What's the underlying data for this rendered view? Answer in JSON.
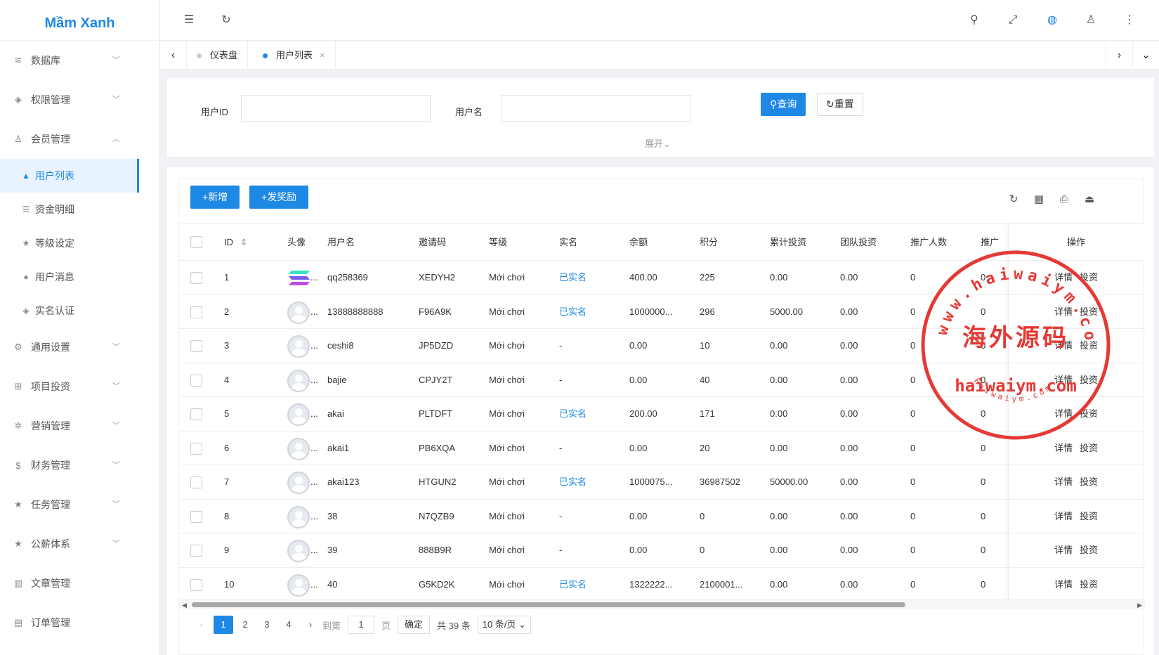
{
  "app": {
    "logo": "Mầm Xanh"
  },
  "sidebar": {
    "items": [
      {
        "label": "数据库",
        "icon": "stack-icon",
        "glyph": "≋",
        "chevron": "﹀"
      },
      {
        "label": "权限管理",
        "icon": "shield-icon",
        "glyph": "◈",
        "chevron": "﹀"
      },
      {
        "label": "会员管理",
        "icon": "user-icon",
        "glyph": "♙",
        "chevron": "︿"
      }
    ],
    "sub_items": [
      {
        "label": "用户列表",
        "icon": "user-fill-icon",
        "glyph": "▲"
      },
      {
        "label": "资金明细",
        "icon": "list-icon",
        "glyph": "☰"
      },
      {
        "label": "等级设定",
        "icon": "star-icon",
        "glyph": "★"
      },
      {
        "label": "用户消息",
        "icon": "message-icon",
        "glyph": "●"
      },
      {
        "label": "实名认证",
        "icon": "verify-icon",
        "glyph": "◈"
      }
    ],
    "items_after": [
      {
        "label": "通用设置",
        "icon": "gear-icon",
        "glyph": "⚙",
        "chevron": "﹀"
      },
      {
        "label": "项目投资",
        "icon": "grid-icon",
        "glyph": "⊞",
        "chevron": "﹀"
      },
      {
        "label": "营销管理",
        "icon": "marketing-icon",
        "glyph": "✲",
        "chevron": "﹀"
      },
      {
        "label": "财务管理",
        "icon": "dollar-icon",
        "glyph": "$",
        "chevron": "﹀"
      },
      {
        "label": "任务管理",
        "icon": "star-icon",
        "glyph": "★",
        "chevron": "﹀"
      },
      {
        "label": "公薪体系",
        "icon": "star-icon",
        "glyph": "★",
        "chevron": "﹀"
      },
      {
        "label": "文章管理",
        "icon": "book-icon",
        "glyph": "▥",
        "chevron": ""
      },
      {
        "label": "订单管理",
        "icon": "clipboard-icon",
        "glyph": "▤",
        "chevron": ""
      }
    ]
  },
  "topbar": {
    "icons": [
      {
        "name": "menu-fold-icon",
        "glyph": "☰"
      },
      {
        "name": "refresh-icon",
        "glyph": "↻"
      },
      {
        "name": "search-icon",
        "glyph": "⚲"
      },
      {
        "name": "fullscreen-icon",
        "glyph": "⤢"
      },
      {
        "name": "globe-icon",
        "glyph": "◍"
      },
      {
        "name": "user-icon",
        "glyph": "♙"
      },
      {
        "name": "more-vertical-icon",
        "glyph": "⋮"
      }
    ]
  },
  "tabs": {
    "prev_glyph": "‹",
    "next_glyph": "›",
    "dropdown_glyph": "⌄",
    "close_glyph": "×",
    "items": [
      {
        "label": "仪表盘"
      },
      {
        "label": "用户列表"
      }
    ]
  },
  "search": {
    "user_id_label": "用户ID",
    "username_label": "用户名",
    "user_id_value": "",
    "username_value": "",
    "query_label": "查询",
    "query_glyph": "⚲",
    "reset_label": "重置",
    "reset_glyph": "↻",
    "expand_label": "展开",
    "expand_glyph": "⌄"
  },
  "toolbar": {
    "add_label": "新增",
    "reward_label": "发奖励",
    "plus_glyph": "+",
    "icons": [
      {
        "name": "refresh-icon",
        "glyph": "↻"
      },
      {
        "name": "columns-icon",
        "glyph": "▦"
      },
      {
        "name": "print-icon",
        "glyph": "⎙"
      },
      {
        "name": "export-icon",
        "glyph": "⏏"
      }
    ]
  },
  "table": {
    "columns": [
      "ID",
      "头像",
      "用户名",
      "邀请码",
      "等级",
      "实名",
      "余额",
      "积分",
      "累计投资",
      "团队投资",
      "推广人数",
      "推广",
      "操作"
    ],
    "sort_glyph": "⇕",
    "detail_label": "详情",
    "invest_label": "投资",
    "rows": [
      {
        "id": "1",
        "avatar": "logo",
        "avatar_ellipsis": "...",
        "username": "qq258369",
        "invite": "XEDYH2",
        "level": "Mới chơi",
        "realname": "已实名",
        "balance": "400.00",
        "points": "225",
        "total_invest": "0.00",
        "team_invest": "0.00",
        "promoted": "0",
        "promo2": "0"
      },
      {
        "id": "2",
        "avatar": "default",
        "avatar_ellipsis": "...",
        "username": "13888888888",
        "invite": "F96A9K",
        "level": "Mới chơi",
        "realname": "已实名",
        "balance": "1000000...",
        "points": "296",
        "total_invest": "5000.00",
        "team_invest": "0.00",
        "promoted": "0",
        "promo2": "0"
      },
      {
        "id": "3",
        "avatar": "default",
        "avatar_ellipsis": "...",
        "username": "ceshi8",
        "invite": "JP5DZD",
        "level": "Mới chơi",
        "realname": "-",
        "balance": "0.00",
        "points": "10",
        "total_invest": "0.00",
        "team_invest": "0.00",
        "promoted": "0",
        "promo2": "0"
      },
      {
        "id": "4",
        "avatar": "default",
        "avatar_ellipsis": "...",
        "username": "bajie",
        "invite": "CPJY2T",
        "level": "Mới chơi",
        "realname": "-",
        "balance": "0.00",
        "points": "40",
        "total_invest": "0.00",
        "team_invest": "0.00",
        "promoted": "0",
        "promo2": "0"
      },
      {
        "id": "5",
        "avatar": "default",
        "avatar_ellipsis": "...",
        "username": "akai",
        "invite": "PLTDFT",
        "level": "Mới chơi",
        "realname": "已实名",
        "balance": "200.00",
        "points": "171",
        "total_invest": "0.00",
        "team_invest": "0.00",
        "promoted": "0",
        "promo2": "0"
      },
      {
        "id": "6",
        "avatar": "default",
        "avatar_ellipsis": "...",
        "username": "akai1",
        "invite": "PB6XQA",
        "level": "Mới chơi",
        "realname": "-",
        "balance": "0.00",
        "points": "20",
        "total_invest": "0.00",
        "team_invest": "0.00",
        "promoted": "0",
        "promo2": "0"
      },
      {
        "id": "7",
        "avatar": "default",
        "avatar_ellipsis": "...",
        "username": "akai123",
        "invite": "HTGUN2",
        "level": "Mới chơi",
        "realname": "已实名",
        "balance": "1000075...",
        "points": "36987502",
        "total_invest": "50000.00",
        "team_invest": "0.00",
        "promoted": "0",
        "promo2": "0"
      },
      {
        "id": "8",
        "avatar": "default",
        "avatar_ellipsis": "...",
        "username": "38",
        "invite": "N7QZB9",
        "level": "Mới chơi",
        "realname": "-",
        "balance": "0.00",
        "points": "0",
        "total_invest": "0.00",
        "team_invest": "0.00",
        "promoted": "0",
        "promo2": "0"
      },
      {
        "id": "9",
        "avatar": "default",
        "avatar_ellipsis": "...",
        "username": "39",
        "invite": "888B9R",
        "level": "Mới chơi",
        "realname": "-",
        "balance": "0.00",
        "points": "0",
        "total_invest": "0.00",
        "team_invest": "0.00",
        "promoted": "0",
        "promo2": "0"
      },
      {
        "id": "10",
        "avatar": "default",
        "avatar_ellipsis": "...",
        "username": "40",
        "invite": "G5KD2K",
        "level": "Mới chơi",
        "realname": "已实名",
        "balance": "1322222...",
        "points": "2100001...",
        "total_invest": "0.00",
        "team_invest": "0.00",
        "promoted": "0",
        "promo2": "0"
      }
    ]
  },
  "pagination": {
    "prev_glyph": "‹",
    "next_glyph": "›",
    "pages": [
      "1",
      "2",
      "3",
      "4"
    ],
    "current": "1",
    "goto_label": "到第",
    "goto_value": "1",
    "page_label": "页",
    "confirm_label": "确定",
    "total_label": "共 39 条",
    "page_size_label": "10 条/页 ⌄"
  },
  "watermark": {
    "center_text": "海外源码",
    "bottom_text": "haiwaiym.com",
    "ring_text": "www.haiwaiym.com",
    "inner_ring_text": "haiwaiym.com"
  },
  "colors": {
    "primary": "#1e88e5",
    "stamp": "#e53935"
  }
}
